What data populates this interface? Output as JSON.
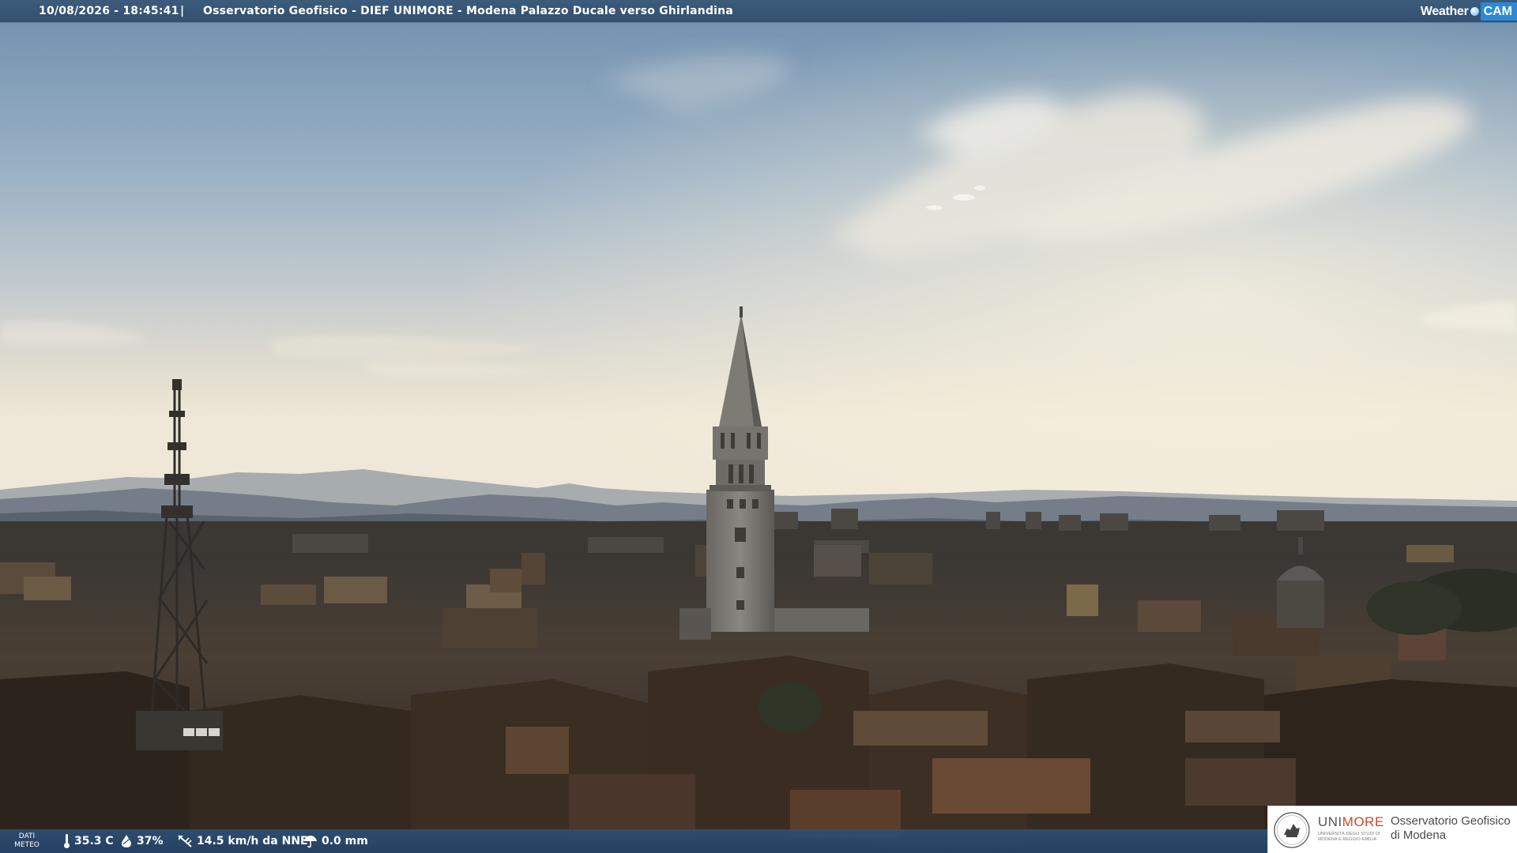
{
  "header": {
    "timestamp": "10/08/2026 - 18:45:41",
    "separator": "|",
    "title": "Osservatorio Geofisico - DIEF UNIMORE - Modena Palazzo Ducale verso Ghirlandina",
    "brand_word": "Weather",
    "brand_cam": "CAM"
  },
  "weather": {
    "label_line1": "DATI",
    "label_line2": "METEO",
    "temperature": "35.3 C",
    "humidity": "37%",
    "wind": "14.5 km/h da NNE",
    "rain": "0.0 mm"
  },
  "logo": {
    "university_part1": "UNI",
    "university_part2": "MORE",
    "university_full": "UNIVERSITÀ DEGLI STUDI DI MODENA E REGGIO EMILIA",
    "observatory": "Osservatorio Geofisico di Modena"
  },
  "colors": {
    "bar_blue": "#3a5878",
    "brand_blue": "#2b89d6",
    "unimore_red": "#c94a2c"
  }
}
